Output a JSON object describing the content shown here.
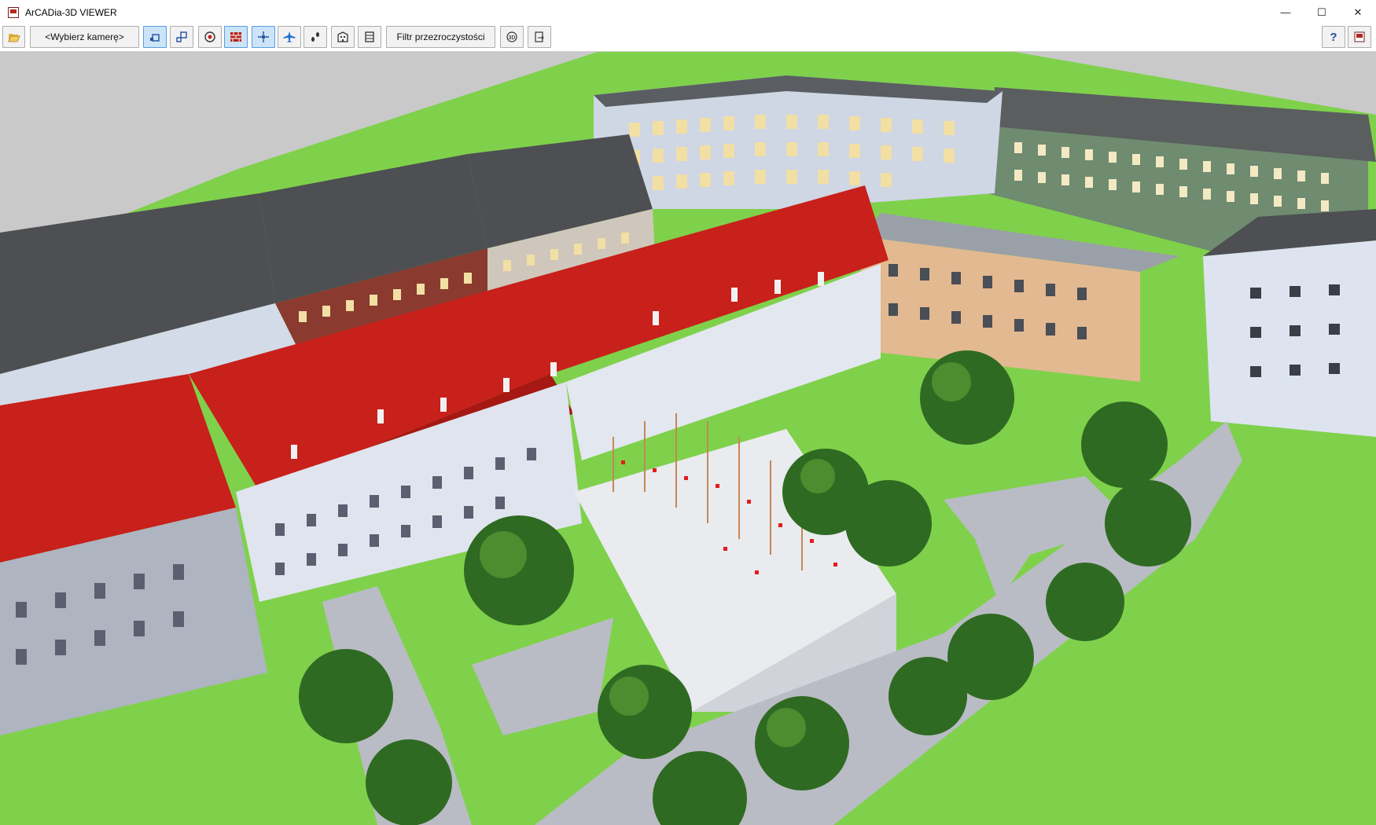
{
  "window": {
    "title": "ArCADia-3D VIEWER",
    "controls": {
      "minimize": "—",
      "maximize": "☐",
      "close": "✕"
    }
  },
  "toolbar": {
    "open_icon": "folder-open-icon",
    "camera_select_label": "<Wybierz kamerę>",
    "tools": [
      {
        "name": "view-mode-1-icon",
        "active": true
      },
      {
        "name": "view-mode-2-icon",
        "active": false
      },
      {
        "name": "material-icon",
        "active": false
      },
      {
        "name": "wall-brick-icon",
        "active": true
      },
      {
        "name": "orbit-icon",
        "active": true
      },
      {
        "name": "fly-icon",
        "active": false
      },
      {
        "name": "walk-icon",
        "active": false
      },
      {
        "name": "building-section-icon",
        "active": false
      },
      {
        "name": "building-floors-icon",
        "active": false
      }
    ],
    "transparency_filter_label": "Filtr przezroczystości",
    "rotate3d_label": "3D",
    "export_icon": "export-3d-icon",
    "help_label": "?",
    "app_menu_icon": "app-menu-icon"
  },
  "colors": {
    "grass": "#7fd14b",
    "roof_red": "#c8201b",
    "roof_grey": "#5a5a5a",
    "facade_light": "#d9dde6",
    "facade_brick": "#8a3a2e",
    "path": "#b9bcc4",
    "sky_ground": "#c9c9c9",
    "tree": "#2f6a22"
  }
}
